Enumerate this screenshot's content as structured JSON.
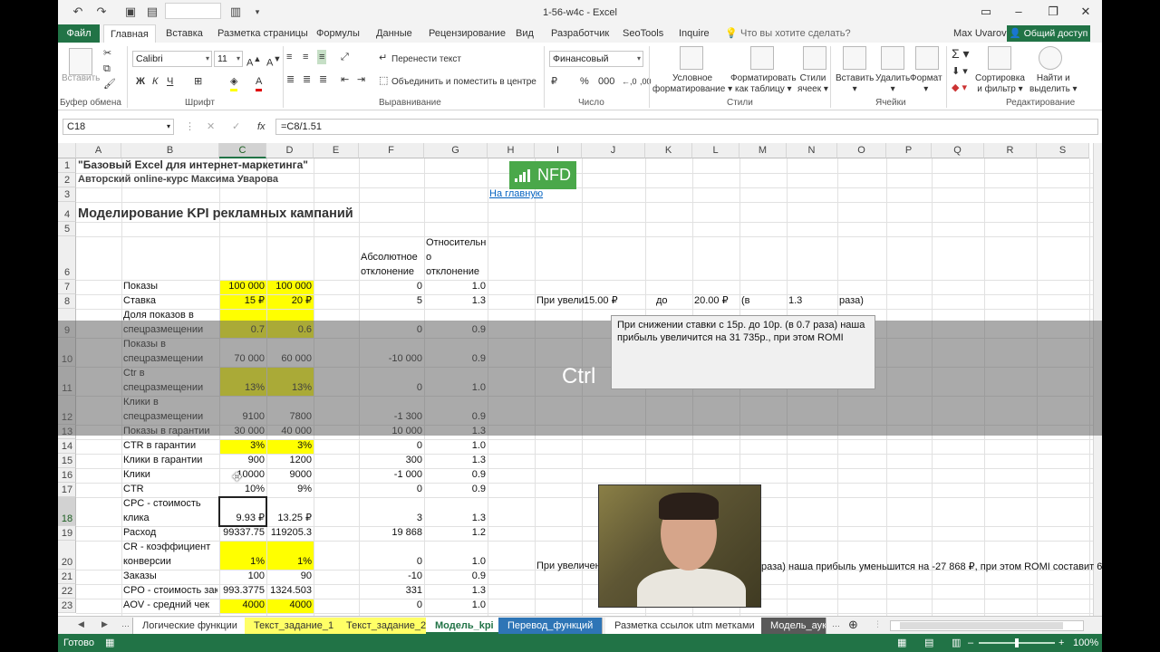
{
  "window": {
    "title": "1-56-w4c - Excel",
    "user": "Max Uvarov",
    "share": "Общий доступ"
  },
  "ribbon_tabs": [
    "Файл",
    "Главная",
    "Вставка",
    "Разметка страницы",
    "Формулы",
    "Данные",
    "Рецензирование",
    "Вид",
    "Разработчик",
    "SeoTools",
    "Inquire",
    "Что вы хотите сделать?"
  ],
  "ribbon": {
    "paste": "Вставить",
    "font_name": "Calibri",
    "font_size": "11",
    "wrap_text": "Перенести текст",
    "merge_center": "Объединить и поместить в центре",
    "number_format": "Финансовый",
    "cond_format": [
      "Условное",
      "форматирование"
    ],
    "format_table": [
      "Форматировать",
      "как таблицу"
    ],
    "cell_styles": [
      "Стили",
      "ячеек"
    ],
    "insert": "Вставить",
    "delete": "Удалить",
    "format": "Формат",
    "sort_filter": [
      "Сортировка",
      "и фильтр"
    ],
    "find_select": [
      "Найти и",
      "выделить"
    ],
    "groups": [
      "Буфер обмена",
      "Шрифт",
      "Выравнивание",
      "Число",
      "Стили",
      "Ячейки",
      "Редактирование"
    ]
  },
  "formula_bar": {
    "name_box": "C18",
    "formula": "=C8/1.51"
  },
  "columns": [
    "A",
    "B",
    "C",
    "D",
    "E",
    "F",
    "G",
    "H",
    "I",
    "J",
    "K",
    "L",
    "M",
    "N",
    "O",
    "P",
    "Q",
    "R",
    "S"
  ],
  "rows": [
    "1",
    "2",
    "3",
    "4",
    "5",
    "6",
    "7",
    "8",
    "9",
    "10",
    "11",
    "12",
    "13",
    "14",
    "15",
    "16",
    "17",
    "18",
    "19",
    "20",
    "21",
    "22",
    "23"
  ],
  "sheet": {
    "a1": "\"Базовый Excel для интернет-маркетинга\"",
    "a2": "Авторский online-курс Максима Уварова",
    "h3": "На главную",
    "a4": "Моделирование KPI рекламных кампаний",
    "logo": "NFD",
    "f6": [
      "Абсолютное",
      "отклонение"
    ],
    "g6": [
      "Относительн",
      "о",
      "отклонение"
    ],
    "r7": [
      "Показы",
      "100 000",
      "100 000",
      "0",
      "1.0"
    ],
    "r8": [
      "Ставка",
      "15 ₽",
      "20 ₽",
      "5",
      "1.3"
    ],
    "r8_extra": [
      "При увели",
      "15.00 ₽",
      "до",
      "20.00 ₽",
      "(в",
      "1.3",
      "раза)"
    ],
    "r9": [
      "Доля показов в",
      "спецразмещении",
      "0.7",
      "0.6",
      "0",
      "0.9"
    ],
    "r10": [
      "Показы в",
      "спецразмещении",
      "70 000",
      "60 000",
      "-10 000",
      "0.9"
    ],
    "r11": [
      "Ctr в",
      "спецразмещении",
      "13%",
      "13%",
      "0",
      "1.0"
    ],
    "r12": [
      "Клики в",
      "спецразмещении",
      "9100",
      "7800",
      "-1 300",
      "0.9"
    ],
    "r13": [
      "Показы в гарантии",
      "30 000",
      "40 000",
      "10 000",
      "1.3"
    ],
    "r14": [
      "CTR в гарантии",
      "3%",
      "3%",
      "0",
      "1.0"
    ],
    "r15": [
      "Клики в гарантии",
      "900",
      "1200",
      "300",
      "1.3"
    ],
    "r16": [
      "Клики",
      "10000",
      "9000",
      "-1 000",
      "0.9"
    ],
    "r17": [
      "CTR",
      "10%",
      "9%",
      "0",
      "0.9"
    ],
    "r18": [
      "CPC - стоимость",
      "клика",
      "9.93 ₽",
      "13.25 ₽",
      "3",
      "1.3"
    ],
    "r19": [
      "Расход",
      "99337.75",
      "119205.3",
      "19 868",
      "1.2"
    ],
    "r20": [
      "CR - коэффициент",
      "конверсии",
      "1%",
      "1%",
      "0",
      "1.0"
    ],
    "r20_extra_left": "При увеличен",
    "r20_extra_right": "раза) наша прибыль уменьшится на -27 868 ₽, при этом ROMI составит 6",
    "r21": [
      "Заказы",
      "100",
      "90",
      "-10",
      "0.9"
    ],
    "r22": [
      "CPO - стоимость зака",
      "993.3775",
      "1324.503",
      "331",
      "1.3"
    ],
    "r23": [
      "AOV - средний чек",
      "4000",
      "4000",
      "0",
      "1.0"
    ]
  },
  "tooltip": [
    "При снижении ставки с 15р. до 10р. (в 0.7 раза) наша",
    "прибыль увеличится на 31 735р., при этом ROMI"
  ],
  "ctrl_text": "Ctrl",
  "sheet_tabs": [
    "Логические функции",
    "Текст_задание_1",
    "Текст_задание_2",
    "Модель_kpi",
    "Перевод_функций",
    "Разметка ссылок utm метками",
    "Модель_аук"
  ],
  "active_sheet": "Модель_kpi",
  "status": {
    "ready": "Готово",
    "zoom": "100%"
  },
  "colors": {
    "excel_green": "#217346",
    "highlight_yellow": "#ffff00",
    "link": "#0563c1"
  }
}
